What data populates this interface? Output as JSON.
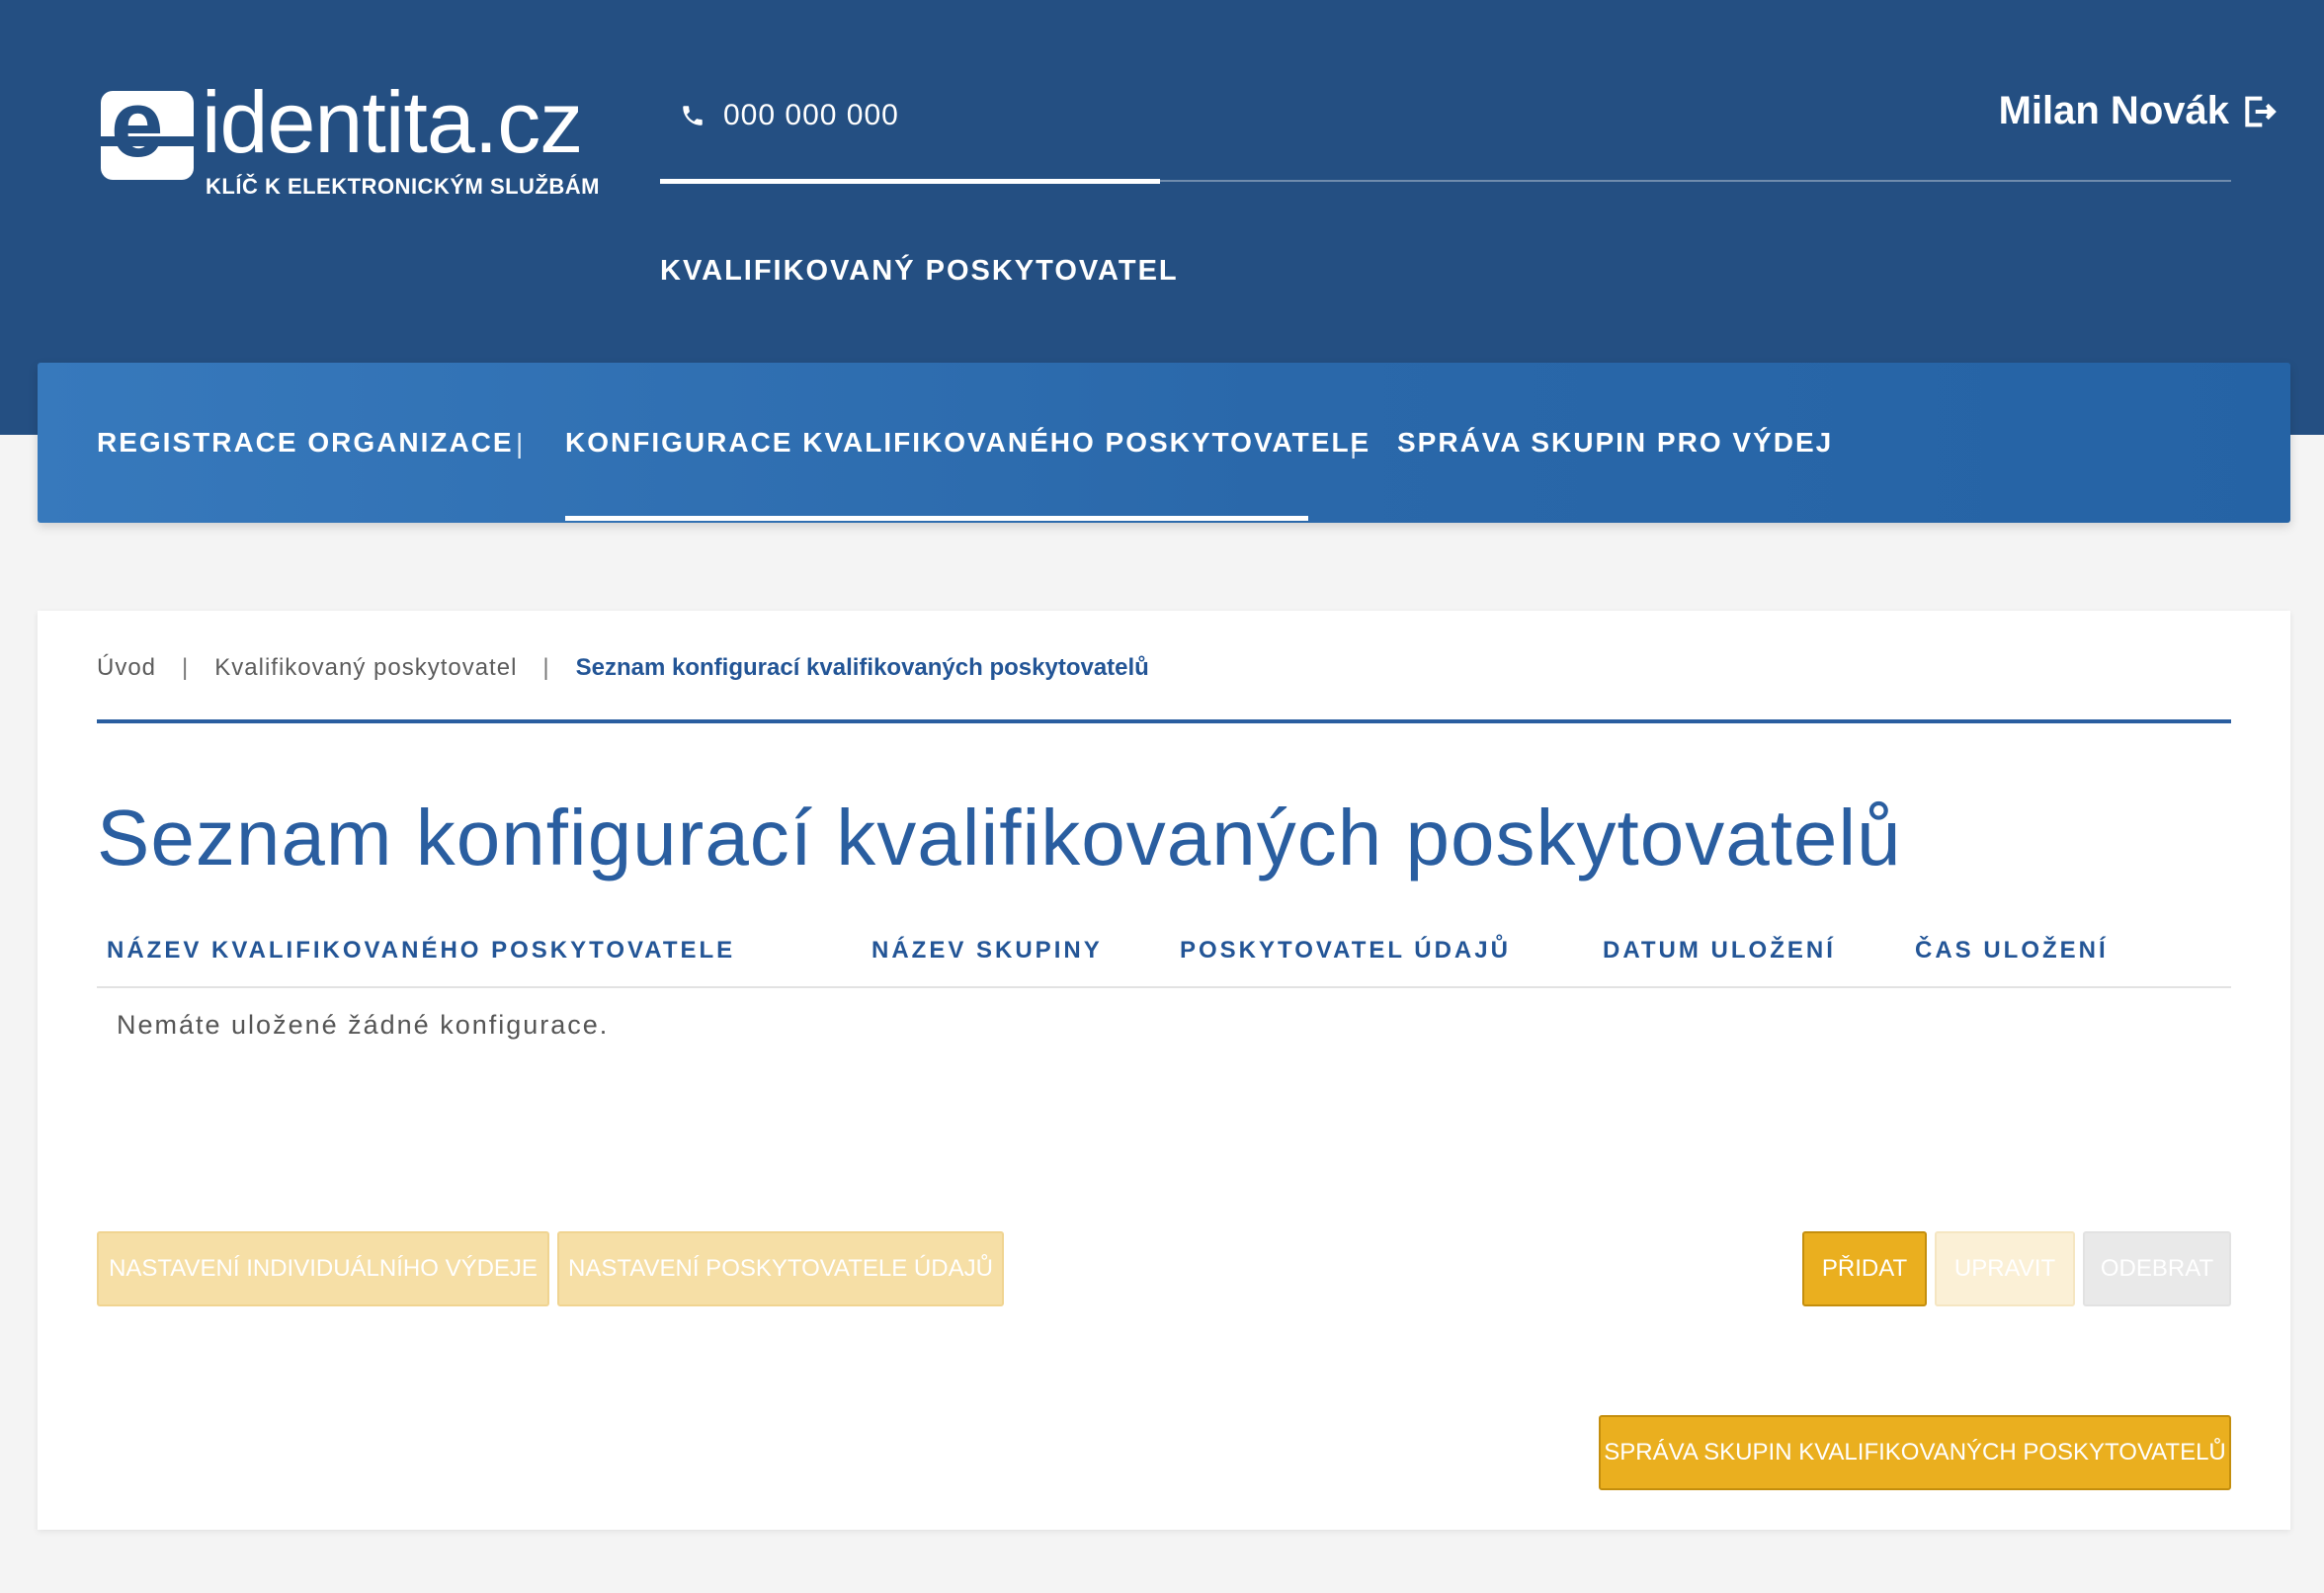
{
  "header": {
    "logo_text": "identita.cz",
    "logo_tagline": "KLÍČ K ELEKTRONICKÝM SLUŽBÁM",
    "phone": "000 000 000",
    "active_tab": "KVALIFIKOVANÝ POSKYTOVATEL",
    "user_name": "Milan Novák"
  },
  "nav": {
    "items": [
      {
        "label": "REGISTRACE ORGANIZACE"
      },
      {
        "label": "KONFIGURACE KVALIFIKOVANÉHO POSKYTOVATELE"
      },
      {
        "label": "SPRÁVA SKUPIN PRO VÝDEJ"
      }
    ],
    "separator": "|"
  },
  "breadcrumb": {
    "items": [
      "Úvod",
      "Kvalifikovaný poskytovatel",
      "Seznam konfigurací kvalifikovaných poskytovatelů"
    ],
    "separator": "|"
  },
  "page": {
    "title": "Seznam konfigurací kvalifikovaných poskytovatelů"
  },
  "table": {
    "columns": [
      "NÁZEV KVALIFIKOVANÉHO POSKYTOVATELE",
      "NÁZEV SKUPINY",
      "POSKYTOVATEL ÚDAJŮ",
      "DATUM ULOŽENÍ",
      "ČAS ULOŽENÍ"
    ],
    "empty_message": "Nemáte uložené žádné konfigurace."
  },
  "buttons": {
    "individual": "NASTAVENÍ INDIVIDUÁLNÍHO VÝDEJE",
    "provider": "NASTAVENÍ POSKYTOVATELE ÚDAJŮ",
    "add": "PŘIDAT",
    "edit": "UPRAVIT",
    "remove": "ODEBRAT",
    "groups": "SPRÁVA SKUPIN KVALIFIKOVANÝCH POSKYTOVATELŮ"
  },
  "colors": {
    "header_bg": "#244f82",
    "nav_bg": "#2f6fb3",
    "accent_blue": "#235596",
    "primary_button": "#eaaf1f"
  }
}
